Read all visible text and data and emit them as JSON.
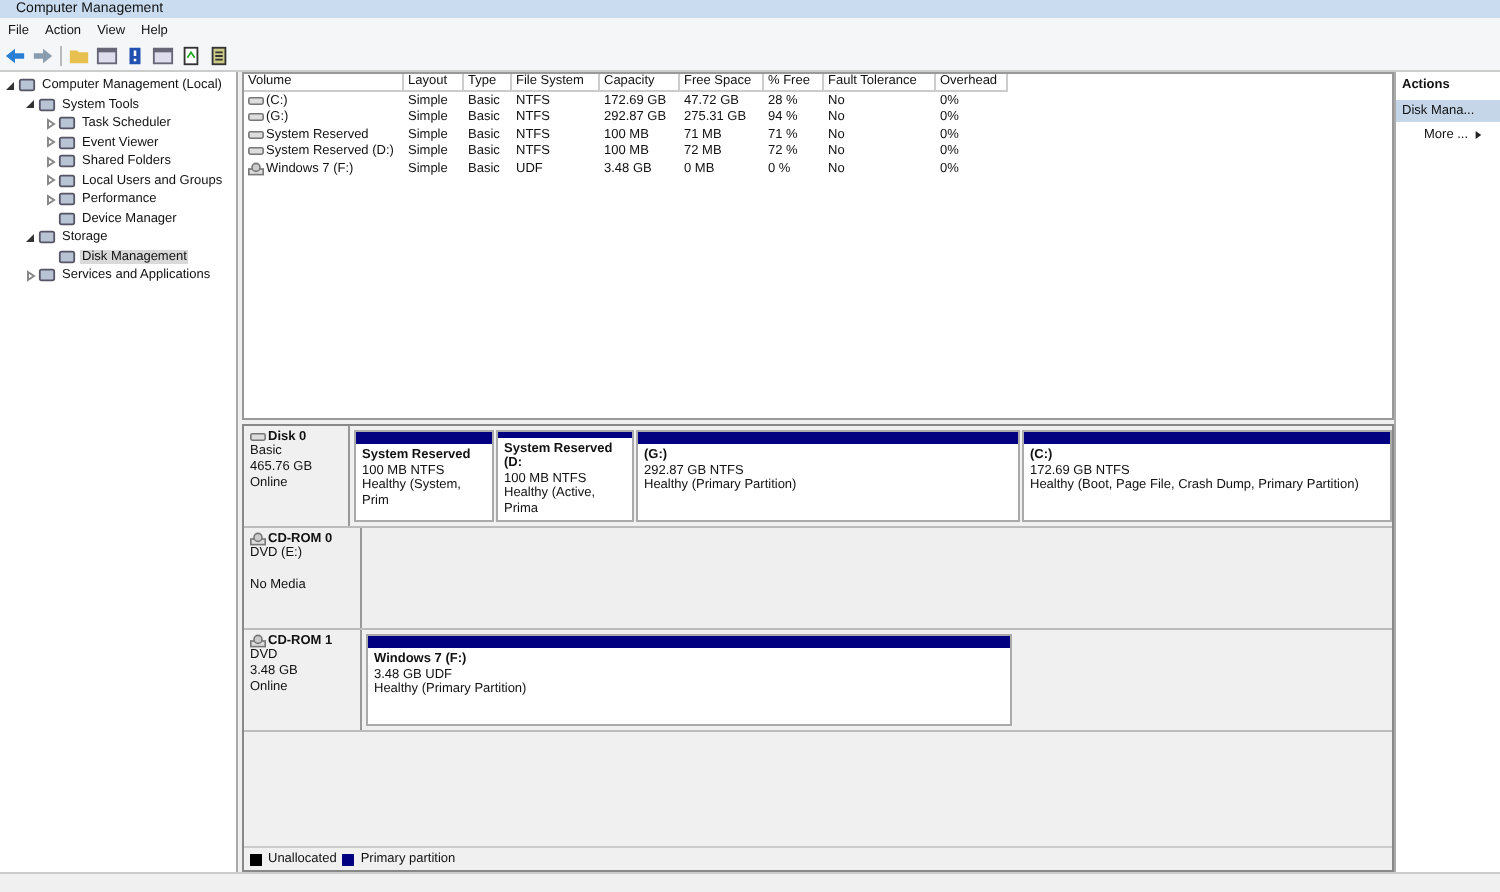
{
  "window": {
    "title": "Computer Management"
  },
  "menu": [
    "File",
    "Action",
    "View",
    "Help"
  ],
  "tree": [
    {
      "label": "Computer Management (Local)",
      "expanded": true,
      "selected": false,
      "children": [
        {
          "label": "System Tools",
          "expanded": true,
          "selected": false,
          "children": [
            {
              "label": "Task Scheduler",
              "expanded": false,
              "selected": false
            },
            {
              "label": "Event Viewer",
              "expanded": false,
              "selected": false
            },
            {
              "label": "Shared Folders",
              "expanded": false,
              "selected": false
            },
            {
              "label": "Local Users and Groups",
              "expanded": false,
              "selected": false
            },
            {
              "label": "Performance",
              "expanded": false,
              "selected": false
            },
            {
              "label": "Device Manager",
              "selected": false
            }
          ]
        },
        {
          "label": "Storage",
          "expanded": true,
          "selected": false,
          "children": [
            {
              "label": "Disk Management",
              "selected": true
            }
          ]
        },
        {
          "label": "Services and Applications",
          "expanded": false,
          "selected": false
        }
      ]
    }
  ],
  "table": {
    "columns": [
      "Volume",
      "Layout",
      "Type",
      "File System",
      "Capacity",
      "Free Space",
      "% Free",
      "Fault Tolerance",
      "Overhead"
    ],
    "rows": [
      {
        "kind": "disk",
        "cells": [
          "(C:)",
          "Simple",
          "Basic",
          "NTFS",
          "172.69 GB",
          "47.72 GB",
          "28 %",
          "No",
          "0%"
        ]
      },
      {
        "kind": "disk",
        "cells": [
          "(G:)",
          "Simple",
          "Basic",
          "NTFS",
          "292.87 GB",
          "275.31 GB",
          "94 %",
          "No",
          "0%"
        ]
      },
      {
        "kind": "disk",
        "cells": [
          "System Reserved",
          "Simple",
          "Basic",
          "NTFS",
          "100 MB",
          "71 MB",
          "71 %",
          "No",
          "0%"
        ]
      },
      {
        "kind": "disk",
        "cells": [
          "System Reserved (D:)",
          "Simple",
          "Basic",
          "NTFS",
          "100 MB",
          "72 MB",
          "72 %",
          "No",
          "0%"
        ]
      },
      {
        "kind": "cd",
        "cells": [
          "Windows 7 (F:)",
          "Simple",
          "Basic",
          "UDF",
          "3.48 GB",
          "0 MB",
          "0 %",
          "No",
          "0%"
        ]
      }
    ]
  },
  "disks": [
    {
      "kind": "disk",
      "name": "Disk 0",
      "info": [
        "Basic",
        "465.76 GB",
        "Online"
      ],
      "partitions": [
        {
          "name": "System Reserved",
          "size": "100 MB NTFS",
          "status": "Healthy (System, Prim"
        },
        {
          "name": "System Reserved  (D:",
          "size": "100 MB NTFS",
          "status": "Healthy (Active, Prima"
        },
        {
          "name": "(G:)",
          "size": "292.87 GB NTFS",
          "status": "Healthy (Primary Partition)"
        },
        {
          "name": "(C:)",
          "size": "172.69 GB NTFS",
          "status": "Healthy (Boot, Page File, Crash Dump, Primary Partition)"
        }
      ]
    },
    {
      "kind": "cd",
      "name": "CD-ROM 0",
      "info": [
        "DVD (E:)",
        "No Media"
      ]
    },
    {
      "kind": "cd",
      "name": "CD-ROM 1",
      "info": [
        "DVD",
        "3.48 GB",
        "Online"
      ],
      "partitions": [
        {
          "name": "Windows 7  (F:)",
          "size": "3.48 GB UDF",
          "status": "Healthy (Primary Partition)"
        }
      ]
    }
  ],
  "legend": [
    {
      "label": "Unallocated",
      "color": "#000000"
    },
    {
      "label": "Primary partition",
      "color": "#000080"
    }
  ],
  "actions": {
    "title": "Actions",
    "items": [
      {
        "label": "Disk Mana...",
        "kind": "header"
      },
      {
        "label": "More ...",
        "kind": "more"
      }
    ]
  }
}
